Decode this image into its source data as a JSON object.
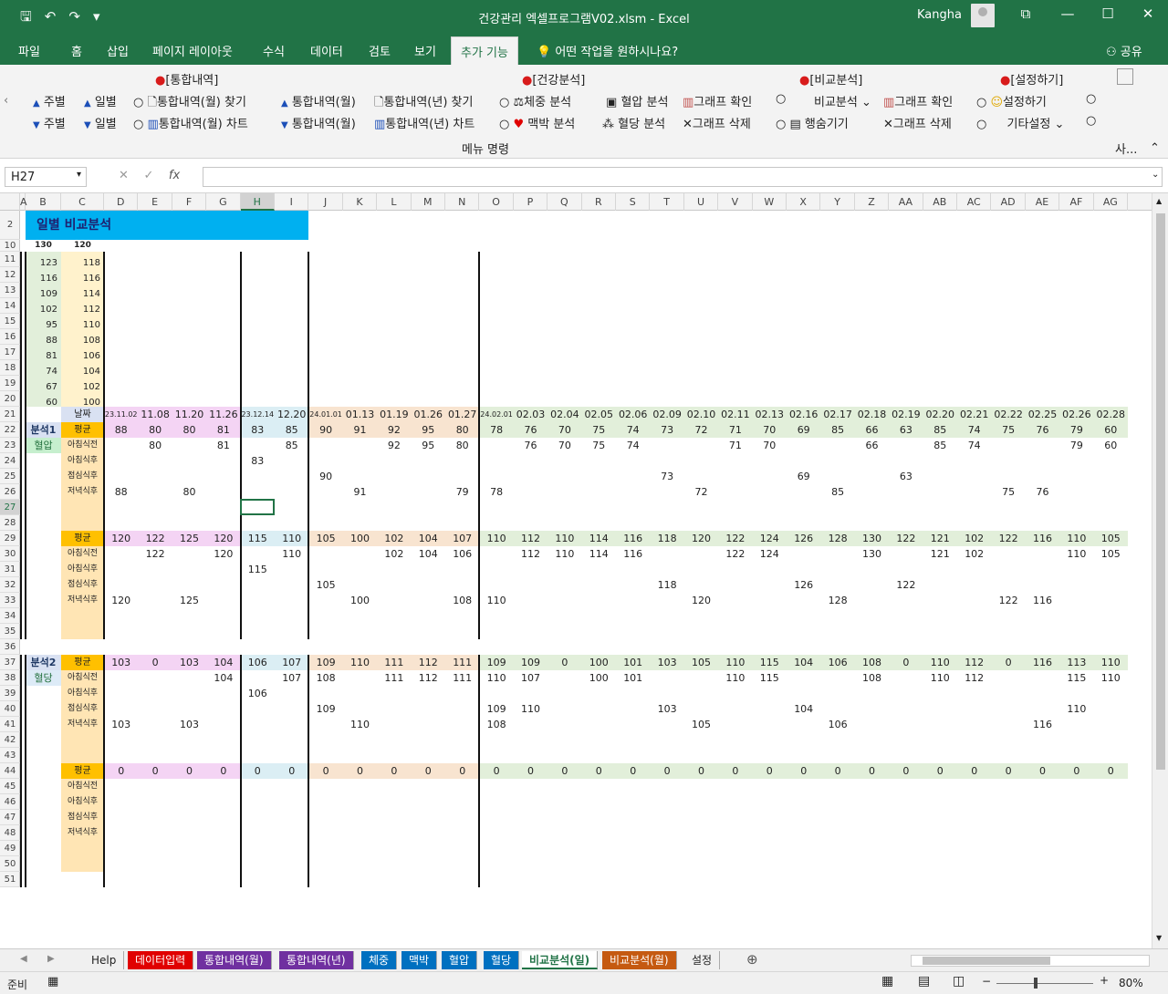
{
  "window": {
    "title": "건강관리 엑셀프로그램V02.xlsm  -  Excel",
    "user": "Kangha"
  },
  "ribbon_tabs": [
    "파일",
    "홈",
    "삽입",
    "페이지 레이아웃",
    "수식",
    "데이터",
    "검토",
    "보기",
    "추가 기능"
  ],
  "tell_me": "어떤 작업을 원하시나요?",
  "share": "공유",
  "ribbon": {
    "groups": {
      "g1": "[통합내역]",
      "g2": "[건강분석]",
      "g3": "[비교분석]",
      "g4": "[설정하기]"
    },
    "weekly": "주별",
    "daily": "일별",
    "find_month": "통합내역(월) 찾기",
    "chart_month": "통합내역(월) 차트",
    "tot_month": "통합내역(월)",
    "find_year": "통합내역(년) 찾기",
    "chart_year": "통합내역(년) 차트",
    "weight_an": "체중 분석",
    "pulse_an": "맥박 분석",
    "bp_an": "혈압 분석",
    "sugar_an": "혈당 분석",
    "graph_check": "그래프 확인",
    "graph_del": "그래프 삭제",
    "compare_an": "비교분석",
    "hide_rows": "행숨기기",
    "settings": "설정하기",
    "other_settings": "기타설정",
    "footer": "메뉴 명령",
    "more": "사..."
  },
  "namebox": "H27",
  "columns": [
    "A",
    "B",
    "C",
    "D",
    "E",
    "F",
    "G",
    "H",
    "I",
    "J",
    "K",
    "L",
    "M",
    "N",
    "O",
    "P",
    "Q",
    "R",
    "S",
    "T",
    "U",
    "V",
    "W",
    "X",
    "Y",
    "Z",
    "AA",
    "AB",
    "AC",
    "AD",
    "AE",
    "AF",
    "AG"
  ],
  "selected_col": "H",
  "selected_row": 27,
  "rows": [
    2,
    10,
    11,
    12,
    13,
    14,
    15,
    16,
    17,
    18,
    19,
    20,
    21,
    22,
    23,
    24,
    25,
    26,
    27,
    28,
    29,
    30,
    31,
    32,
    33,
    34,
    35,
    36,
    37,
    38,
    39,
    40,
    41,
    42,
    43,
    44,
    45,
    46,
    47,
    48,
    49,
    50,
    51
  ],
  "sheet": {
    "title": "일별 비교분석",
    "r10": {
      "B": "130",
      "C": "120"
    },
    "axis_b": [
      "123",
      "116",
      "109",
      "102",
      "95",
      "88",
      "81",
      "74",
      "67",
      "60"
    ],
    "axis_c": [
      "118",
      "116",
      "114",
      "112",
      "110",
      "108",
      "106",
      "104",
      "102",
      "100"
    ],
    "date_label": "날짜",
    "dates": [
      "23.11.02",
      "11.08",
      "11.20",
      "11.26",
      "23.12.14",
      "12.20",
      "24.01.01",
      "01.13",
      "01.19",
      "01.26",
      "01.27",
      "24.02.01",
      "02.03",
      "02.04",
      "02.05",
      "02.06",
      "02.09",
      "02.10",
      "02.11",
      "02.13",
      "02.16",
      "02.17",
      "02.18",
      "02.19",
      "02.20",
      "02.21",
      "02.22",
      "02.25",
      "02.26",
      "02.28"
    ],
    "analysis1": "분석1",
    "analysis2": "분석2",
    "bp_label": "혈압",
    "sugar_label": "혈당",
    "avg": "평균",
    "slots": [
      "아침식전",
      "아침식후",
      "점심식후",
      "저녁식후"
    ],
    "bp_low": {
      "avg": [
        "88",
        "80",
        "80",
        "81",
        "83",
        "85",
        "90",
        "91",
        "92",
        "95",
        "80",
        "78",
        "76",
        "70",
        "75",
        "74",
        "73",
        "72",
        "71",
        "70",
        "69",
        "85",
        "66",
        "63",
        "85",
        "74",
        "75",
        "76",
        "79",
        "60"
      ],
      "s1": [
        "",
        "80",
        "",
        "81",
        "",
        "85",
        "",
        "",
        "92",
        "95",
        "80",
        "",
        "76",
        "70",
        "75",
        "74",
        "",
        "",
        "71",
        "70",
        "",
        "",
        "66",
        "",
        "85",
        "74",
        "",
        "",
        "79",
        "60"
      ],
      "s2": [
        "",
        "",
        "",
        "",
        "83",
        "",
        "",
        "",
        "",
        "",
        "",
        "",
        "",
        "",
        "",
        "",
        "",
        "",
        "",
        "",
        "",
        "",
        "",
        "",
        "",
        "",
        "",
        "",
        "",
        ""
      ],
      "s3": [
        "",
        "",
        "",
        "",
        "",
        "",
        "90",
        "",
        "",
        "",
        "",
        "",
        "",
        "",
        "",
        "",
        "73",
        "",
        "",
        "",
        "69",
        "",
        "",
        "63",
        "",
        "",
        "",
        "",
        "",
        ""
      ],
      "s4": [
        "88",
        "",
        "80",
        "",
        "",
        "",
        "",
        "91",
        "",
        "",
        "79",
        "78",
        "",
        "",
        "",
        "",
        "",
        "72",
        "",
        "",
        "",
        "85",
        "",
        "",
        "",
        "",
        "75",
        "76",
        "",
        ""
      ]
    },
    "bp_high": {
      "avg": [
        "120",
        "122",
        "125",
        "120",
        "115",
        "110",
        "105",
        "100",
        "102",
        "104",
        "107",
        "110",
        "112",
        "110",
        "114",
        "116",
        "118",
        "120",
        "122",
        "124",
        "126",
        "128",
        "130",
        "122",
        "121",
        "102",
        "122",
        "116",
        "110",
        "105"
      ],
      "s1": [
        "",
        "122",
        "",
        "120",
        "",
        "110",
        "",
        "",
        "102",
        "104",
        "106",
        "",
        "112",
        "110",
        "114",
        "116",
        "",
        "",
        "122",
        "124",
        "",
        "",
        "130",
        "",
        "121",
        "102",
        "",
        "",
        "110",
        "105"
      ],
      "s2": [
        "",
        "",
        "",
        "",
        "115",
        "",
        "",
        "",
        "",
        "",
        "",
        "",
        "",
        "",
        "",
        "",
        "",
        "",
        "",
        "",
        "",
        "",
        "",
        "",
        "",
        "",
        "",
        "",
        "",
        ""
      ],
      "s3": [
        "",
        "",
        "",
        "",
        "",
        "",
        "105",
        "",
        "",
        "",
        "",
        "",
        "",
        "",
        "",
        "",
        "118",
        "",
        "",
        "",
        "126",
        "",
        "",
        "122",
        "",
        "",
        "",
        "",
        "",
        ""
      ],
      "s4": [
        "120",
        "",
        "125",
        "",
        "",
        "",
        "",
        "100",
        "",
        "",
        "108",
        "110",
        "",
        "",
        "",
        "",
        "",
        "120",
        "",
        "",
        "",
        "128",
        "",
        "",
        "",
        "",
        "122",
        "116",
        "",
        ""
      ]
    },
    "sugar": {
      "avg": [
        "103",
        "0",
        "103",
        "104",
        "106",
        "107",
        "109",
        "110",
        "111",
        "112",
        "111",
        "109",
        "109",
        "0",
        "100",
        "101",
        "103",
        "105",
        "110",
        "115",
        "104",
        "106",
        "108",
        "0",
        "110",
        "112",
        "0",
        "116",
        "113",
        "110"
      ],
      "s1": [
        "",
        "",
        "",
        "104",
        "",
        "107",
        "108",
        "",
        "111",
        "112",
        "111",
        "110",
        "107",
        "",
        "100",
        "101",
        "",
        "",
        "110",
        "115",
        "",
        "",
        "108",
        "",
        "110",
        "112",
        "",
        "",
        "115",
        "110"
      ],
      "s2": [
        "",
        "",
        "",
        "",
        "106",
        "",
        "",
        "",
        "",
        "",
        "",
        "",
        "",
        "",
        "",
        "",
        "",
        "",
        "",
        "",
        "",
        "",
        "",
        "",
        "",
        "",
        "",
        "",
        "",
        ""
      ],
      "s3": [
        "",
        "",
        "",
        "",
        "",
        "",
        "109",
        "",
        "",
        "",
        "",
        "109",
        "110",
        "",
        "",
        "",
        "103",
        "",
        "",
        "",
        "104",
        "",
        "",
        "",
        "",
        "",
        "",
        "",
        "110",
        ""
      ],
      "s4": [
        "103",
        "",
        "103",
        "",
        "",
        "",
        "",
        "110",
        "",
        "",
        "",
        "108",
        "",
        "",
        "",
        "",
        "",
        "105",
        "",
        "",
        "",
        "106",
        "",
        "",
        "",
        "",
        "",
        "116",
        "",
        ""
      ]
    },
    "zero": [
      "0",
      "0",
      "0",
      "0",
      "0",
      "0",
      "0",
      "0",
      "0",
      "0",
      "0",
      "0",
      "0",
      "0",
      "0",
      "0",
      "0",
      "0",
      "0",
      "0",
      "0",
      "0",
      "0",
      "0",
      "0",
      "0",
      "0",
      "0",
      "0",
      "0"
    ]
  },
  "sheet_tabs": [
    {
      "label": "Help",
      "color": "#f0f0f0",
      "text": "#222"
    },
    {
      "label": "데이터입력",
      "color": "#e00000",
      "text": "#fff"
    },
    {
      "label": "통합내역(월)",
      "color": "#7030a0",
      "text": "#fff"
    },
    {
      "label": "통합내역(년)",
      "color": "#7030a0",
      "text": "#fff"
    },
    {
      "label": "체중",
      "color": "#0070c0",
      "text": "#fff"
    },
    {
      "label": "맥박",
      "color": "#0070c0",
      "text": "#fff"
    },
    {
      "label": "혈압",
      "color": "#0070c0",
      "text": "#fff"
    },
    {
      "label": "혈당",
      "color": "#0070c0",
      "text": "#fff"
    },
    {
      "label": "비교분석(일)",
      "color": "#ffffff",
      "text": "#217346"
    },
    {
      "label": "비교분석(월)",
      "color": "#c55a11",
      "text": "#fff"
    },
    {
      "label": "설정",
      "color": "#f0f0f0",
      "text": "#222"
    }
  ],
  "status": {
    "ready": "준비",
    "zoom": "80%"
  },
  "colors": {
    "accent": "#217346",
    "title_fill": "#00b0f0",
    "bp_low": "#e2efda",
    "bp_high": "#fff2cc",
    "row_label": "#ffe5b4"
  }
}
